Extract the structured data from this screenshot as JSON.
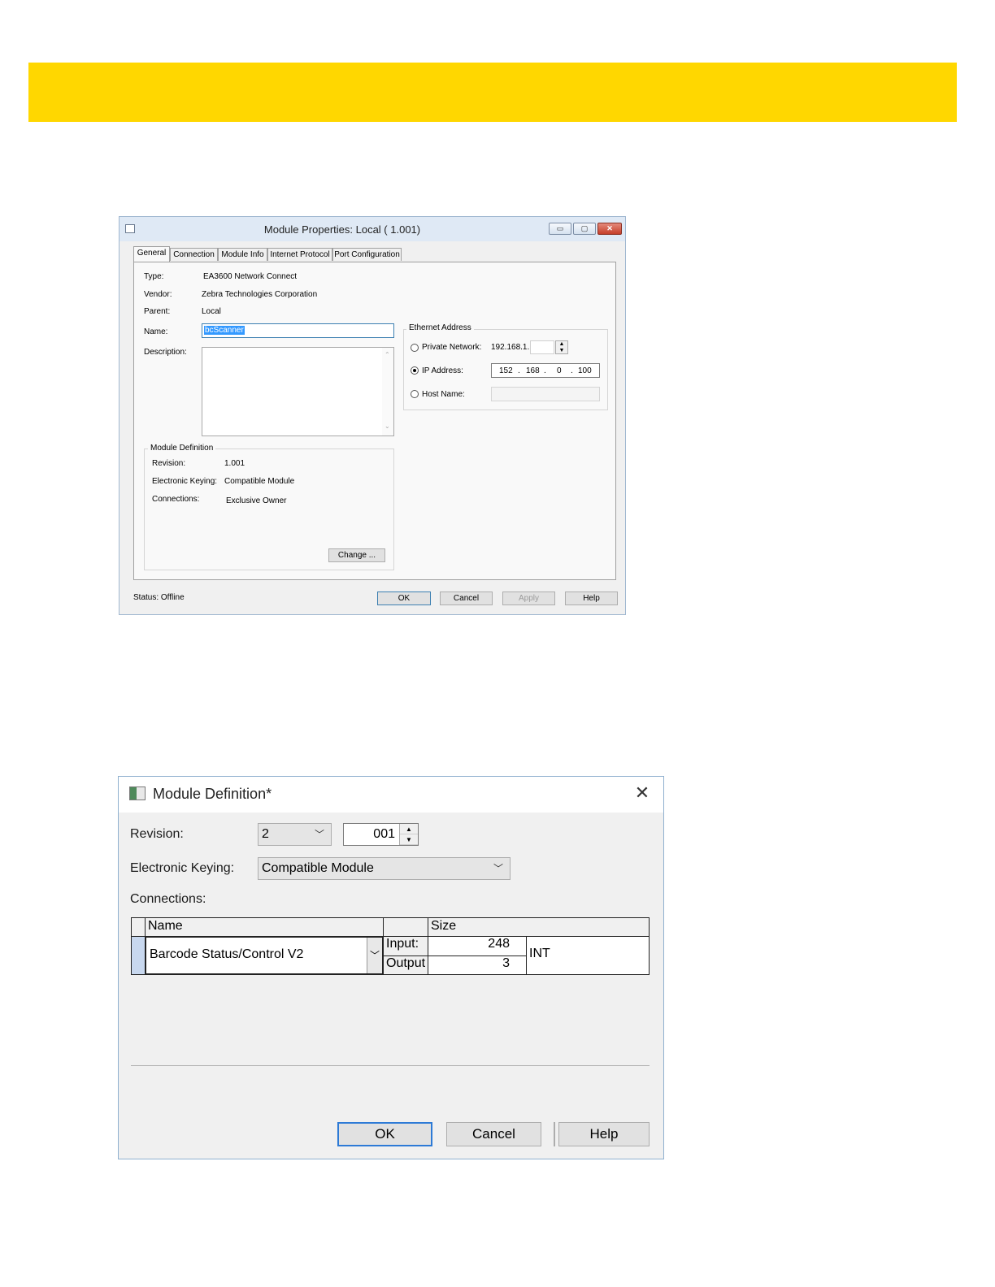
{
  "module_properties": {
    "title": "Module Properties: Local ( 1.001)",
    "window_buttons": {
      "minimize": "▭",
      "maximize": "▢",
      "close": "✕"
    },
    "tabs": [
      {
        "label": "General"
      },
      {
        "label": "Connection"
      },
      {
        "label": "Module Info"
      },
      {
        "label": "Internet Protocol"
      },
      {
        "label": "Port Configuration"
      }
    ],
    "fields": {
      "type_label": "Type:",
      "type_value": "EA3600 Network Connect",
      "vendor_label": "Vendor:",
      "vendor_value": "Zebra Technologies Corporation",
      "parent_label": "Parent:",
      "parent_value": "Local",
      "name_label": "Name:",
      "name_value": "bcScanner",
      "description_label": "Description:",
      "description_value": ""
    },
    "ethernet": {
      "caption": "Ethernet Address",
      "private_network_label": "Private Network:",
      "private_network_prefix": "192.168.1.",
      "ip_address_label": "IP Address:",
      "ip_octets": [
        "152",
        "168",
        "0",
        "100"
      ],
      "host_name_label": "Host Name:",
      "selected": "ip_address"
    },
    "module_definition": {
      "caption": "Module Definition",
      "revision_label": "Revision:",
      "revision_value": "1.001",
      "keying_label": "Electronic Keying:",
      "keying_value": "Compatible Module",
      "connections_label": "Connections:",
      "connections_value": "Exclusive Owner",
      "change_button": "Change ..."
    },
    "status": "Status:  Offline",
    "buttons": {
      "ok": "OK",
      "cancel": "Cancel",
      "apply": "Apply",
      "help": "Help"
    }
  },
  "module_definition_dialog": {
    "title": "Module Definition*",
    "close_glyph": "✕",
    "revision_label": "Revision:",
    "revision_major": "2",
    "revision_minor": "001",
    "keying_label": "Electronic Keying:",
    "keying_value": "Compatible Module",
    "connections_label": "Connections:",
    "table": {
      "headers": {
        "name": "Name",
        "size": "Size"
      },
      "row": {
        "name": "Barcode Status/Control V2",
        "input_label": "Input:",
        "input_value": "248",
        "output_label": "Output",
        "output_value": "3",
        "type": "INT"
      }
    },
    "buttons": {
      "ok": "OK",
      "cancel": "Cancel",
      "help": "Help"
    }
  }
}
